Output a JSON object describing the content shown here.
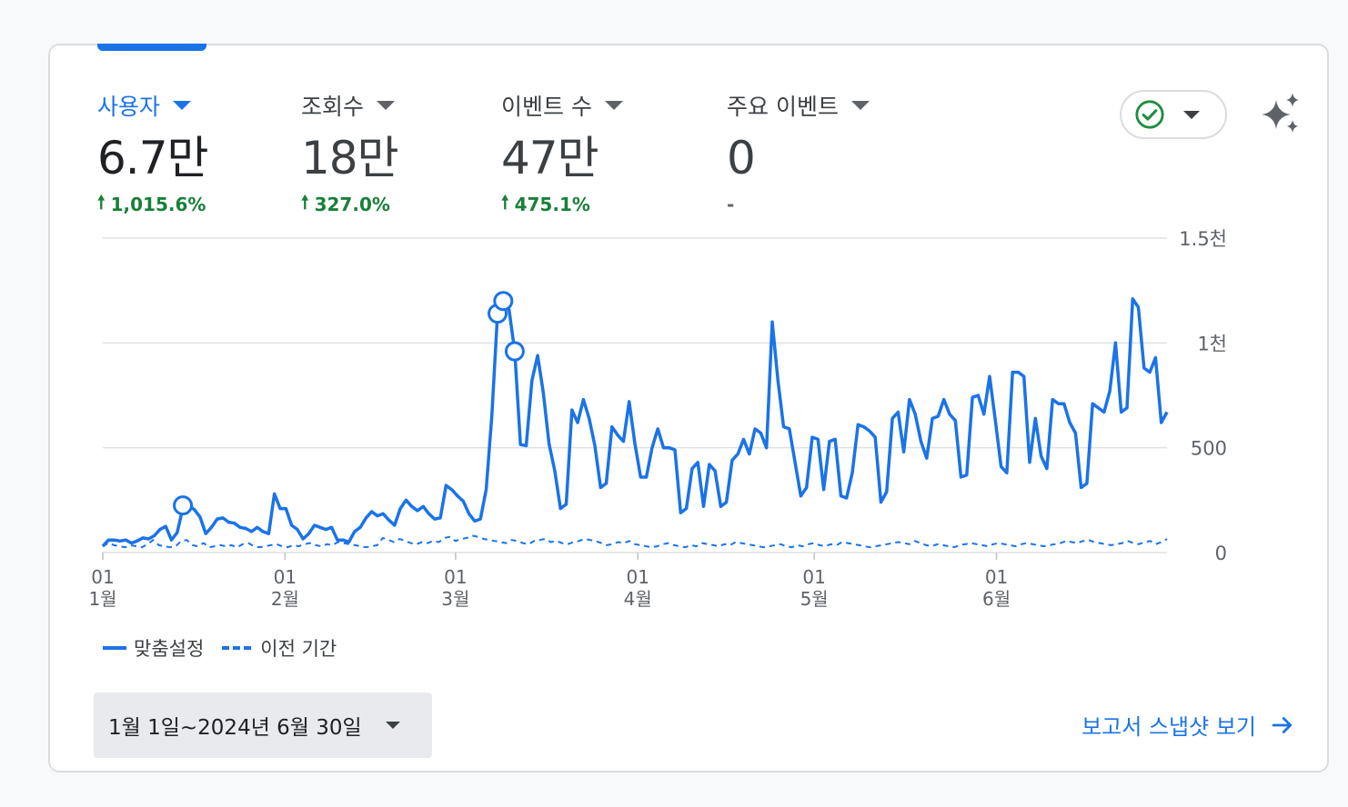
{
  "colors": {
    "accent": "#1a73e8",
    "positive": "#188038",
    "text": "#202124",
    "muted": "#5f6368",
    "grid": "#e0e0e0",
    "check": "#1e8e3e"
  },
  "metrics": [
    {
      "label": "사용자",
      "value": "6.7만",
      "change": "1,015.6%",
      "active": true
    },
    {
      "label": "조회수",
      "value": "18만",
      "change": "327.0%",
      "active": false
    },
    {
      "label": "이벤트 수",
      "value": "47만",
      "change": "475.1%",
      "active": false
    },
    {
      "label": "주요 이벤트",
      "value": "0",
      "change": "-",
      "active": false
    }
  ],
  "status_icon": "check-circle-icon",
  "insights_icon": "sparkle-icon",
  "legend": {
    "current": "맞춤설정",
    "previous": "이전 기간"
  },
  "date_range": "1월 1일~2024년 6월 30일",
  "snapshot_link": "보고서 스냅샷 보기",
  "chart_data": {
    "type": "line",
    "x_range": [
      "2024-01-01",
      "2024-06-30"
    ],
    "ylim": [
      0,
      1500
    ],
    "y_ticks": [
      {
        "value": 0,
        "label": "0"
      },
      {
        "value": 500,
        "label": "500"
      },
      {
        "value": 1000,
        "label": "1천"
      },
      {
        "value": 1500,
        "label": "1.5천"
      }
    ],
    "x_ticks": [
      {
        "date": "2024-01-01",
        "day": "01",
        "month": "1월"
      },
      {
        "date": "2024-02-01",
        "day": "01",
        "month": "2월"
      },
      {
        "date": "2024-03-01",
        "day": "01",
        "month": "3월"
      },
      {
        "date": "2024-04-01",
        "day": "01",
        "month": "4월"
      },
      {
        "date": "2024-05-01",
        "day": "01",
        "month": "5월"
      },
      {
        "date": "2024-06-01",
        "day": "01",
        "month": "6월"
      }
    ],
    "grid": true,
    "legend_position": "bottom-left",
    "series": [
      {
        "name": "맞춤설정",
        "style": "solid",
        "values": [
          30,
          60,
          60,
          55,
          60,
          45,
          55,
          70,
          65,
          80,
          110,
          125,
          60,
          95,
          215,
          225,
          205,
          170,
          90,
          120,
          160,
          165,
          145,
          140,
          120,
          115,
          100,
          120,
          100,
          90,
          280,
          210,
          210,
          130,
          110,
          65,
          90,
          130,
          120,
          110,
          120,
          60,
          60,
          50,
          100,
          120,
          165,
          195,
          175,
          185,
          155,
          130,
          210,
          250,
          220,
          200,
          220,
          185,
          160,
          165,
          320,
          300,
          270,
          245,
          185,
          150,
          160,
          300,
          650,
          1140,
          1200,
          1160,
          960,
          515,
          510,
          820,
          940,
          760,
          520,
          390,
          210,
          230,
          680,
          620,
          730,
          640,
          510,
          310,
          330,
          600,
          560,
          530,
          720,
          520,
          360,
          360,
          500,
          590,
          500,
          500,
          490,
          190,
          210,
          400,
          430,
          220,
          420,
          390,
          220,
          240,
          440,
          470,
          540,
          470,
          590,
          570,
          500,
          1100,
          820,
          600,
          590,
          430,
          270,
          310,
          550,
          540,
          300,
          530,
          540,
          270,
          260,
          380,
          610,
          600,
          580,
          550,
          240,
          290,
          640,
          670,
          480,
          730,
          660,
          530,
          450,
          640,
          650,
          730,
          660,
          630,
          360,
          370,
          740,
          750,
          660,
          840,
          630,
          410,
          380,
          860,
          860,
          840,
          430,
          640,
          460,
          400,
          730,
          710,
          710,
          620,
          570,
          310,
          330,
          710,
          690,
          670,
          770,
          1000,
          670,
          690,
          1210,
          1170,
          880,
          860,
          930,
          620,
          670
        ]
      },
      {
        "name": "이전 기간",
        "style": "dashed",
        "values": [
          30,
          45,
          35,
          30,
          25,
          35,
          30,
          25,
          40,
          60,
          35,
          30,
          25,
          30,
          55,
          60,
          35,
          30,
          45,
          25,
          30,
          35,
          30,
          35,
          25,
          40,
          45,
          30,
          25,
          30,
          35,
          40,
          30,
          25,
          35,
          30,
          40,
          45,
          35,
          30,
          40,
          35,
          50,
          45,
          40,
          35,
          30,
          25,
          30,
          35,
          70,
          60,
          50,
          65,
          55,
          45,
          40,
          50,
          45,
          55,
          50,
          70,
          75,
          55,
          65,
          70,
          80,
          75,
          65,
          60,
          55,
          50,
          45,
          60,
          55,
          45,
          40,
          55,
          60,
          65,
          50,
          55,
          45,
          40,
          50,
          55,
          65,
          60,
          55,
          45,
          35,
          40,
          50,
          45,
          55,
          40,
          35,
          30,
          25,
          30,
          40,
          45,
          35,
          30,
          25,
          35,
          30,
          45,
          40,
          35,
          30,
          40,
          35,
          50,
          45,
          40,
          35,
          30,
          25,
          30,
          35,
          40,
          30,
          25,
          35,
          30,
          40,
          45,
          35,
          30,
          40,
          35,
          50,
          45,
          40,
          35,
          30,
          25,
          30,
          35,
          40,
          45,
          50,
          45,
          40,
          55,
          45,
          35,
          30,
          40,
          35,
          30,
          25,
          35,
          40,
          45,
          40,
          35,
          30,
          40,
          45,
          40,
          35,
          30,
          40,
          45,
          40,
          35,
          30,
          35,
          40,
          45,
          55,
          50,
          45,
          55,
          60,
          50,
          45,
          40,
          35,
          40,
          45,
          55,
          45,
          40,
          50,
          55,
          40,
          50,
          65
        ]
      }
    ],
    "markers": [
      {
        "series": 0,
        "index": 14,
        "value": 225
      },
      {
        "series": 0,
        "index": 69,
        "value": 1140
      },
      {
        "series": 0,
        "index": 70,
        "value": 1200
      },
      {
        "series": 0,
        "index": 72,
        "value": 960
      }
    ]
  }
}
